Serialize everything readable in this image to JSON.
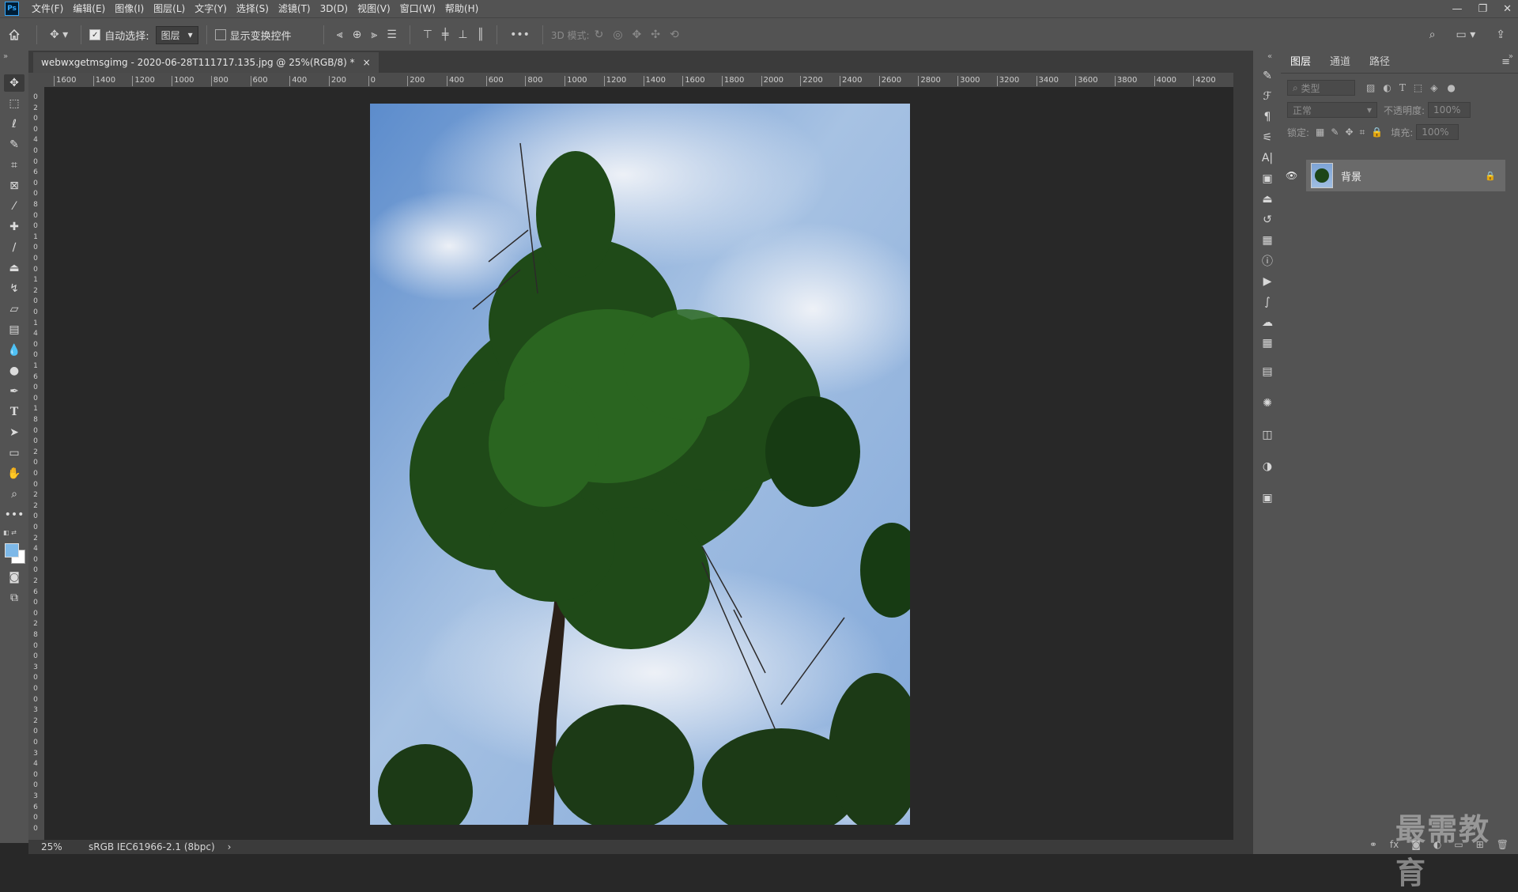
{
  "app": {
    "logo": "Ps"
  },
  "menu": [
    "文件(F)",
    "编辑(E)",
    "图像(I)",
    "图层(L)",
    "文字(Y)",
    "选择(S)",
    "滤镜(T)",
    "3D(D)",
    "视图(V)",
    "窗口(W)",
    "帮助(H)"
  ],
  "window_controls": [
    "—",
    "❐",
    "✕"
  ],
  "options": {
    "auto_select_label": "自动选择:",
    "auto_select_checked": true,
    "target_value": "图层",
    "show_transform_label": "显示变换控件",
    "more": "•••",
    "mode_3d_label": "3D 模式:"
  },
  "document": {
    "tab_title": "webwxgetmsgimg - 2020-06-28T111717.135.jpg @ 25%(RGB/8) *",
    "close": "×"
  },
  "ruler_h": [
    "1600",
    "1400",
    "1200",
    "1000",
    "800",
    "600",
    "400",
    "200",
    "0",
    "200",
    "400",
    "600",
    "800",
    "1000",
    "1200",
    "1400",
    "1600",
    "1800",
    "2000",
    "2200",
    "2400",
    "2600",
    "2800",
    "3000",
    "3200",
    "3400",
    "3600",
    "3800",
    "4000",
    "4200"
  ],
  "ruler_v": [
    "0",
    "2",
    "0",
    "0",
    "4",
    "0",
    "0",
    "6",
    "0",
    "0",
    "8",
    "0",
    "0",
    "1",
    "0",
    "0",
    "0",
    "1",
    "2",
    "0",
    "0",
    "1",
    "4",
    "0",
    "0",
    "1",
    "6",
    "0",
    "0",
    "1",
    "8",
    "0",
    "0",
    "2",
    "0",
    "0",
    "0",
    "2",
    "2",
    "0",
    "0",
    "2",
    "4",
    "0",
    "0",
    "2",
    "6",
    "0",
    "0",
    "2",
    "8",
    "0",
    "0",
    "3",
    "0",
    "0",
    "0",
    "3",
    "2",
    "0",
    "0",
    "3",
    "4",
    "0",
    "0",
    "3",
    "6",
    "0",
    "0"
  ],
  "status": {
    "zoom": "25%",
    "profile": "sRGB IEC61966-2.1 (8bpc)",
    "arrow": "›"
  },
  "layers_panel": {
    "tabs": [
      "图层",
      "通道",
      "路径"
    ],
    "filter_placeholder": "类型",
    "blend_mode": "正常",
    "opacity_label": "不透明度:",
    "opacity_value": "100%",
    "lock_label": "锁定:",
    "fill_label": "填充:",
    "fill_value": "100%",
    "layer_name": "背景"
  },
  "watermark": "最需教育",
  "colors": {
    "ui_bg": "#535353",
    "canvas_bg": "#282828",
    "foreground": "#7db8e8",
    "background": "#ffffff"
  }
}
